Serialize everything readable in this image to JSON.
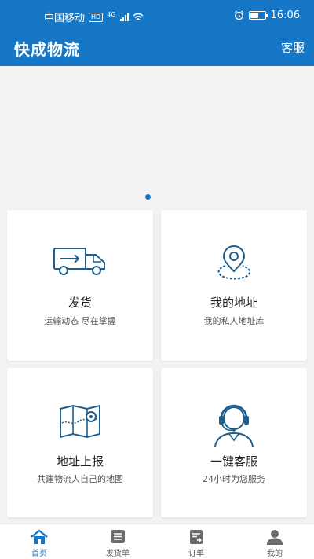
{
  "status_bar": {
    "carrier": "中国移动",
    "hd_badge": "HD",
    "network": "4G",
    "time": "16:06",
    "battery_level": 0.55
  },
  "app_bar": {
    "title": "快成物流",
    "service_label": "客服"
  },
  "banner": {
    "page_count": 1,
    "active_page": 1
  },
  "cards": [
    {
      "icon": "truck-icon",
      "title": "发货",
      "subtitle": "运输动态  尽在掌握"
    },
    {
      "icon": "map-pin-icon",
      "title": "我的地址",
      "subtitle": "我的私人地址库"
    },
    {
      "icon": "folded-map-icon",
      "title": "地址上报",
      "subtitle": "共建物流人自己的地图"
    },
    {
      "icon": "customer-service-icon",
      "title": "一键客服",
      "subtitle": "24小时为您服务"
    }
  ],
  "tabs": [
    {
      "icon": "home-icon",
      "label": "首页",
      "active": true
    },
    {
      "icon": "list-icon",
      "label": "发货单",
      "active": false
    },
    {
      "icon": "order-doc-icon",
      "label": "订单",
      "active": false
    },
    {
      "icon": "user-icon",
      "label": "我的",
      "active": false
    }
  ],
  "colors": {
    "primary": "#1677c6",
    "background": "#f2f2f2",
    "tab_inactive": "#6b6b6b"
  }
}
